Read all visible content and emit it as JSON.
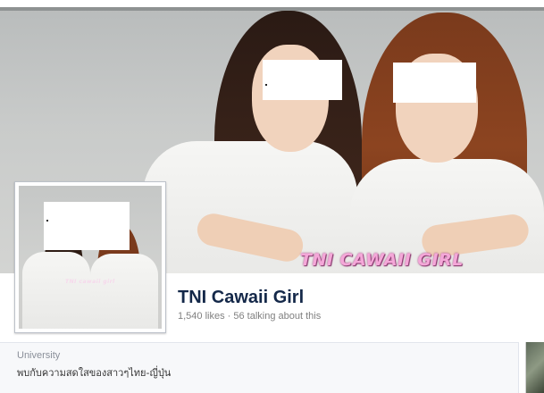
{
  "page": {
    "name": "TNI Cawaii Girl",
    "stats": "1,540 likes · 56 talking about this"
  },
  "cover": {
    "watermark": "TNI CAWAII GIRL"
  },
  "profile": {
    "watermark": "TNI cawaii girl"
  },
  "about": {
    "category": "University",
    "description": "พบกับความสดใสของสาวๆไทย-ญี่ปุ่น"
  },
  "colors": {
    "page_name": "#142849",
    "stats": "#808080",
    "card_background": "#f7f8fa",
    "watermark": "#f4a7d8"
  }
}
